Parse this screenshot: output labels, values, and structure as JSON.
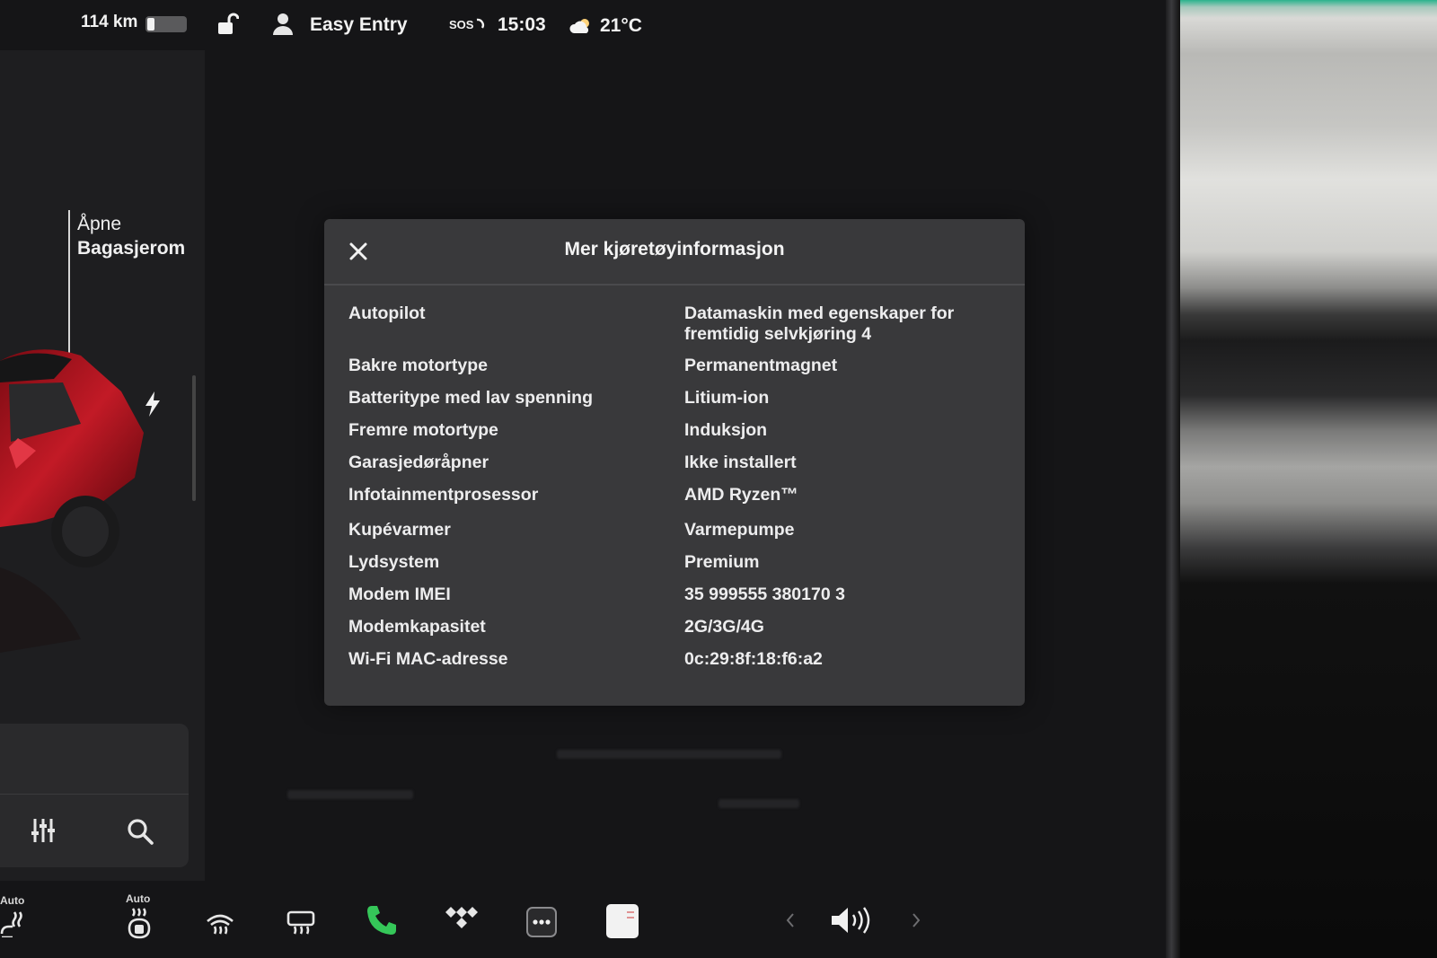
{
  "status_bar": {
    "range": "114 km",
    "profile": "Easy Entry",
    "sos": "SOS",
    "time": "15:03",
    "temperature": "21°C",
    "icons": [
      "battery-icon",
      "lock-open-icon",
      "person-icon",
      "sos-icon",
      "cloud-sun-icon"
    ],
    "battery_level": 0.15
  },
  "left_panel": {
    "trunk_action_line1": "Åpne",
    "trunk_action_line2": "Bagasjerom",
    "icons": [
      "charge-port-icon",
      "equalizer-icon",
      "search-icon"
    ]
  },
  "dialog": {
    "title": "Mer kjøretøyinformasjon",
    "close_icon": "close-icon",
    "rows": [
      {
        "label": "Autopilot",
        "value": "Datamaskin med egenskaper for fremtidig selvkjøring 4"
      },
      {
        "label": "Bakre motortype",
        "value": "Permanentmagnet"
      },
      {
        "label": "Batteritype med lav spenning",
        "value": "Litium-ion"
      },
      {
        "label": "Fremre motortype",
        "value": "Induksjon"
      },
      {
        "label": "Garasjedøråpner",
        "value": "Ikke installert"
      },
      {
        "label": "Infotainmentprosessor",
        "value": "AMD Ryzen™"
      },
      {
        "label": "Kupévarmer",
        "value": "Varmepumpe"
      },
      {
        "label": "Lydsystem",
        "value": "Premium"
      },
      {
        "label": "Modem IMEI",
        "value": "35 999555 380170 3"
      },
      {
        "label": "Modemkapasitet",
        "value": "2G/3G/4G"
      },
      {
        "label": "Wi-Fi MAC-adresse",
        "value": "0c:29:8f:18:f6:a2"
      }
    ]
  },
  "dock": {
    "seat_heater_left_label": "Auto",
    "seat_heater_right_label": "Auto",
    "icons": [
      "seat-heater-left-icon",
      "seat-heater-right-icon",
      "rear-defrost-icon",
      "front-defrost-icon",
      "phone-icon",
      "tidal-icon",
      "more-icon",
      "notes-icon",
      "chevron-left-icon",
      "volume-icon",
      "chevron-right-icon"
    ],
    "accent_phone": "#35c759"
  }
}
